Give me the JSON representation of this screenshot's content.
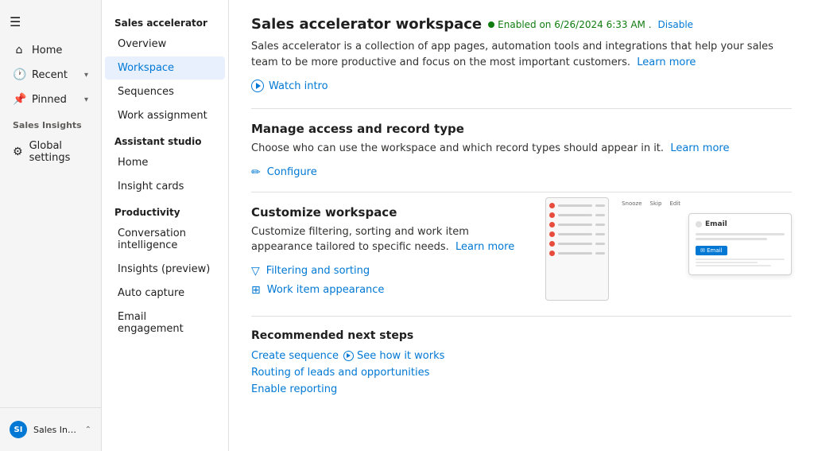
{
  "leftNav": {
    "hamburger": "☰",
    "items": [
      {
        "label": "Home",
        "icon": "⌂"
      },
      {
        "label": "Recent",
        "icon": "🕐",
        "hasChevron": true
      },
      {
        "label": "Pinned",
        "icon": "📌",
        "hasChevron": true
      }
    ],
    "salesInsightsLabel": "Sales Insights",
    "salesInsightsItems": [
      {
        "label": "Global settings",
        "icon": "⚙"
      }
    ],
    "bottomItem": {
      "initials": "SI",
      "label": "Sales Insights sett...",
      "hasChevron": true
    }
  },
  "sidebar": {
    "sections": [
      {
        "label": "Sales accelerator",
        "items": [
          {
            "label": "Overview",
            "active": false
          },
          {
            "label": "Workspace",
            "active": true
          },
          {
            "label": "Sequences",
            "active": false
          },
          {
            "label": "Work assignment",
            "active": false
          }
        ]
      },
      {
        "label": "Assistant studio",
        "items": [
          {
            "label": "Home",
            "active": false
          },
          {
            "label": "Insight cards",
            "active": false
          }
        ]
      },
      {
        "label": "Productivity",
        "items": [
          {
            "label": "Conversation intelligence",
            "active": false
          },
          {
            "label": "Insights (preview)",
            "active": false
          },
          {
            "label": "Auto capture",
            "active": false
          },
          {
            "label": "Email engagement",
            "active": false
          }
        ]
      }
    ]
  },
  "main": {
    "title": "Sales accelerator workspace",
    "statusText": "Enabled on 6/26/2024 6:33 AM .",
    "disableLabel": "Disable",
    "description": "Sales accelerator is a collection of app pages, automation tools and integrations that help your sales team to be more productive and focus on the most important customers.",
    "learnMoreDesc": "Learn more",
    "watchIntroLabel": "Watch intro",
    "sections": {
      "manageAccess": {
        "title": "Manage access and record type",
        "description": "Choose who can use the workspace and which record types should appear in it.",
        "learnMore": "Learn more",
        "configureLabel": "Configure",
        "configureIcon": "✏"
      },
      "customizeWorkspace": {
        "title": "Customize workspace",
        "description": "Customize filtering, sorting and work item appearance tailored to specific needs.",
        "learnMore": "Learn more",
        "filteringLabel": "Filtering and sorting",
        "filterIcon": "▽",
        "workItemLabel": "Work item appearance",
        "workItemIcon": "⊞",
        "previewOverlayTexts": [
          "Snooze",
          "Skip",
          "Edit"
        ]
      },
      "recommendedNextSteps": {
        "title": "Recommended next steps",
        "links": [
          {
            "label": "Create sequence",
            "hasSeeHow": true,
            "seeHowLabel": "See how it works"
          },
          {
            "label": "Routing of leads and opportunities"
          },
          {
            "label": "Enable reporting"
          }
        ]
      }
    },
    "previewDots": [
      {
        "color": "#e74c3c"
      },
      {
        "color": "#e74c3c"
      },
      {
        "color": "#e74c3c"
      },
      {
        "color": "#e74c3c"
      },
      {
        "color": "#e74c3c"
      },
      {
        "color": "#e74c3c"
      }
    ]
  }
}
